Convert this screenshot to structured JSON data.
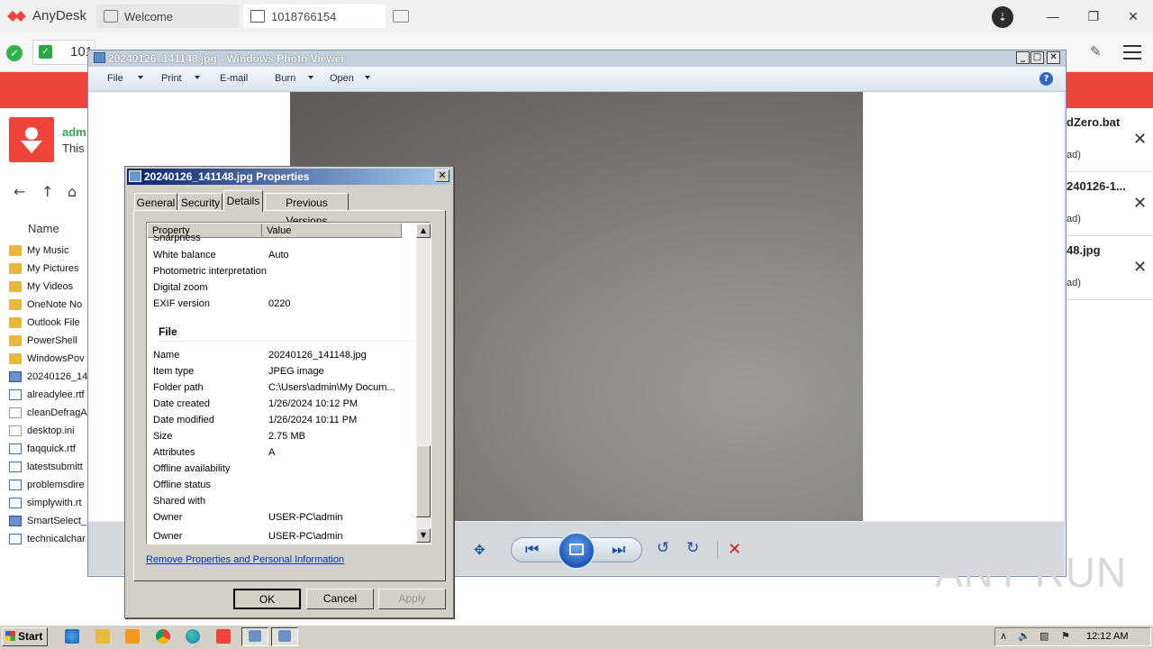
{
  "anydesk": {
    "app_name": "AnyDesk",
    "tabs": [
      {
        "label": "Welcome"
      },
      {
        "label": "1018766154"
      }
    ],
    "address_value": "101",
    "brand_color": "#ef443b"
  },
  "bg_app": {
    "user": "adm",
    "sub": "This",
    "column_header": "Name",
    "files": [
      {
        "name": "My Music",
        "icon": "folder"
      },
      {
        "name": "My Pictures",
        "icon": "folder"
      },
      {
        "name": "My Videos",
        "icon": "folder"
      },
      {
        "name": "OneNote No",
        "icon": "folder"
      },
      {
        "name": "Outlook File",
        "icon": "folder"
      },
      {
        "name": "PowerShell",
        "icon": "folder"
      },
      {
        "name": "WindowsPov",
        "icon": "folder"
      },
      {
        "name": "20240126_14",
        "icon": "img"
      },
      {
        "name": "alreadylee.rtf",
        "icon": "doc"
      },
      {
        "name": "cleanDefragA",
        "icon": "ini"
      },
      {
        "name": "desktop.ini",
        "icon": "ini"
      },
      {
        "name": "faqquick.rtf",
        "icon": "doc"
      },
      {
        "name": "latestsubmitt",
        "icon": "doc"
      },
      {
        "name": "problemsdire",
        "icon": "doc"
      },
      {
        "name": "simplywith.rt",
        "icon": "doc"
      },
      {
        "name": "SmartSelect_",
        "icon": "img"
      },
      {
        "name": "technicalchar",
        "icon": "doc"
      }
    ]
  },
  "downloads": [
    {
      "name": "dZero.bat",
      "sub": "ad)"
    },
    {
      "name": "240126-1...",
      "sub": "ad)"
    },
    {
      "name": "48.jpg",
      "sub": "ad)"
    }
  ],
  "photo_viewer": {
    "title": "20240126_141148.jpg - Windows Photo Viewer",
    "menus": [
      "File",
      "Print",
      "E-mail",
      "Burn",
      "Open"
    ]
  },
  "dialog": {
    "title": "20240126_141148.jpg Properties",
    "tabs": [
      "General",
      "Security",
      "Details",
      "Previous Versions"
    ],
    "active_tab": "Details",
    "columns": [
      "Property",
      "Value"
    ],
    "top_rows": [
      {
        "property": "Sharpness",
        "value": ""
      },
      {
        "property": "White balance",
        "value": "Auto"
      },
      {
        "property": "Photometric interpretation",
        "value": ""
      },
      {
        "property": "Digital zoom",
        "value": ""
      },
      {
        "property": "EXIF version",
        "value": "0220"
      }
    ],
    "section_file": "File",
    "file_rows": [
      {
        "property": "Name",
        "value": "20240126_141148.jpg"
      },
      {
        "property": "Item type",
        "value": "JPEG image"
      },
      {
        "property": "Folder path",
        "value": "C:\\Users\\admin\\My Docum..."
      },
      {
        "property": "Date created",
        "value": "1/26/2024 10:12 PM"
      },
      {
        "property": "Date modified",
        "value": "1/26/2024 10:11 PM"
      },
      {
        "property": "Size",
        "value": "2.75 MB"
      },
      {
        "property": "Attributes",
        "value": "A"
      },
      {
        "property": "Offline availability",
        "value": ""
      },
      {
        "property": "Offline status",
        "value": ""
      },
      {
        "property": "Shared with",
        "value": ""
      },
      {
        "property": "Owner",
        "value": "USER-PC\\admin"
      },
      {
        "property": "Owner",
        "value": "USER-PC\\admin"
      }
    ],
    "remove_link": "Remove Properties and Personal Information",
    "buttons": {
      "ok": "OK",
      "cancel": "Cancel",
      "apply": "Apply"
    }
  },
  "watermark": "ANY RUN",
  "taskbar": {
    "start_label": "Start",
    "clock": "12:12 AM"
  }
}
